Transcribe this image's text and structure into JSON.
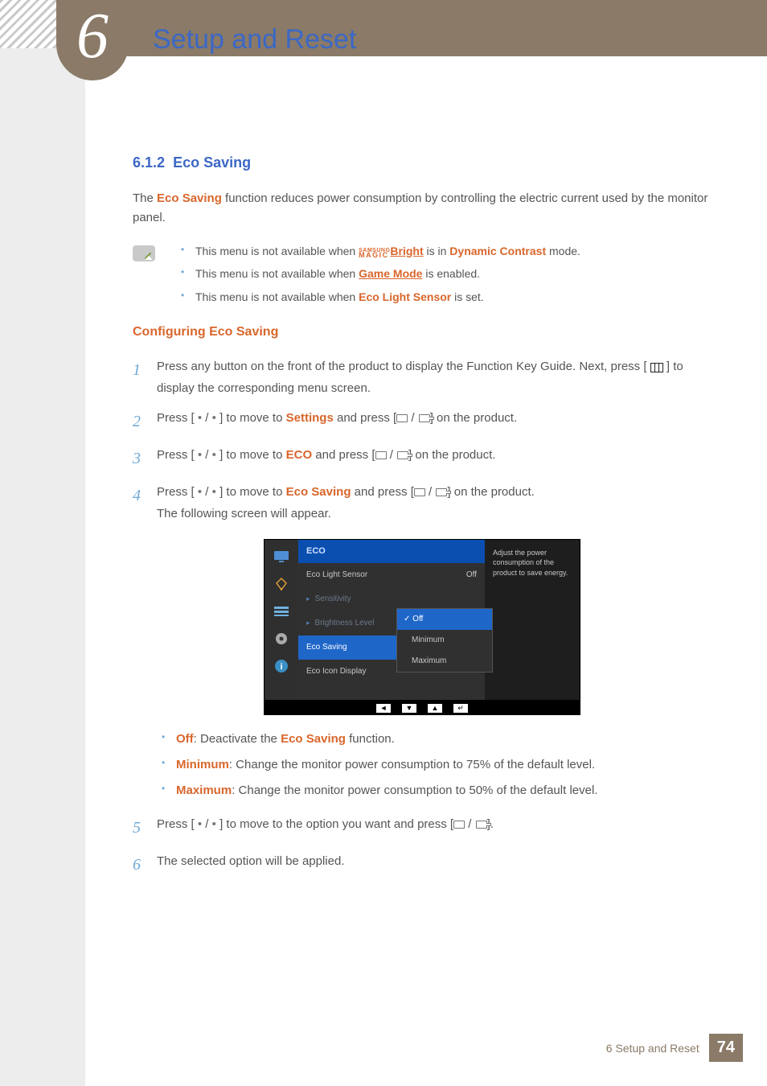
{
  "chapter": {
    "number": "6",
    "title": "Setup and Reset"
  },
  "section": {
    "number": "6.1.2",
    "title": "Eco Saving"
  },
  "intro": {
    "pre": "The ",
    "term": "Eco Saving",
    "post": " function reduces power consumption by controlling the electric current used by the monitor panel."
  },
  "notes": {
    "n1_pre": "This menu is not available when ",
    "n1_brand_top": "SAMSUNG",
    "n1_brand_bot": "MAGIC",
    "n1_link": "Bright",
    "n1_mid": " is in ",
    "n1_term": "Dynamic Contrast",
    "n1_post": " mode.",
    "n2_pre": "This menu is not available when ",
    "n2_link": "Game Mode",
    "n2_post": " is enabled.",
    "n3_pre": "This menu is not available when ",
    "n3_term": "Eco Light Sensor",
    "n3_post": " is set."
  },
  "config_heading": "Configuring Eco Saving",
  "steps": {
    "s1_num": "1",
    "s1_a": "Press any button on the front of the product to display the Function Key Guide. Next, press [ ",
    "s1_b": " ] to display the corresponding menu screen.",
    "s2_num": "2",
    "s2_a": "Press [ ",
    "dot_sep": " / ",
    "s2_b": " ] to move to ",
    "s2_term": "Settings",
    "s2_c": " and press [",
    "s2_d": "] on the product.",
    "s3_num": "3",
    "s3_term": "ECO",
    "s4_num": "4",
    "s4_term": "Eco Saving",
    "s4_tail": "The following screen will appear.",
    "dot": "•"
  },
  "osd": {
    "title": "ECO",
    "rows": {
      "r1": "Eco Light Sensor",
      "r1v": "Off",
      "r2": "Sensitivity",
      "r3": "Brightness Level",
      "r4": "Eco Saving",
      "r5": "Eco Icon Display"
    },
    "popup": {
      "p1": "Off",
      "p2": "Minimum",
      "p3": "Maximum"
    },
    "help": "Adjust the power consumption of the product to save energy.",
    "nav": {
      "b1": "◄",
      "b2": "▼",
      "b3": "▲",
      "b4": "↵"
    }
  },
  "options": {
    "o1_term": "Off",
    "o1_txt": ": Deactivate the ",
    "o1_term2": "Eco Saving",
    "o1_post": " function.",
    "o2_term": "Minimum",
    "o2_txt": ": Change the monitor power consumption to 75% of the default level.",
    "o3_term": "Maximum",
    "o3_txt": ": Change the monitor power consumption to 50% of the default level."
  },
  "steps2": {
    "s5_num": "5",
    "s5_a": "Press [ ",
    "s5_b": " ] to move to the option you want and press [",
    "s5_c": "].",
    "s6_num": "6",
    "s6_txt": "The selected option will be applied."
  },
  "footer": {
    "label": "6 Setup and Reset",
    "page": "74"
  }
}
